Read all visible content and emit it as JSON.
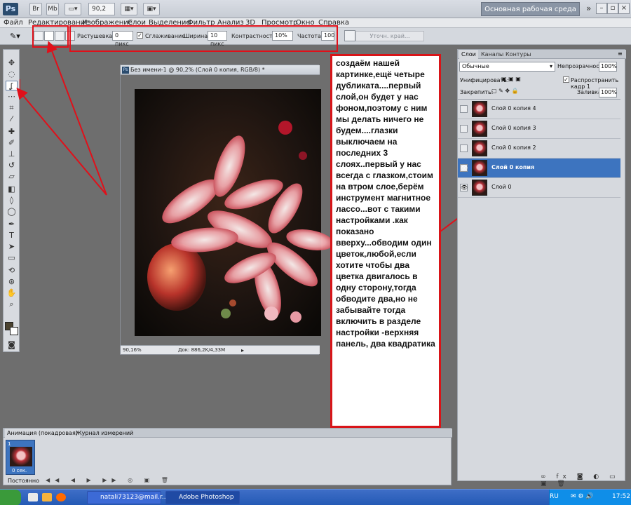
{
  "app": {
    "logo": "Ps",
    "br_label": "Br",
    "mb_label": "Mb",
    "zoom_value": "90,2",
    "workspace_label": "Основная рабочая среда",
    "more_label": "»"
  },
  "menu": [
    "Файл",
    "Редактирование",
    "Изображение",
    "Слои",
    "Выделение",
    "Фильтр",
    "Анализ",
    "3D",
    "Просмотр",
    "Окно",
    "Справка"
  ],
  "options": {
    "feather_label": "Растушевка:",
    "feather_value": "0 пикс",
    "antialias_label": "Сглаживание",
    "width_label": "Ширина:",
    "width_value": "10 пикс",
    "contrast_label": "Контрастность:",
    "contrast_value": "10%",
    "frequency_label": "Частота:",
    "frequency_value": "100",
    "refine_label": "Уточн. край..."
  },
  "document": {
    "title": "Без имени-1 @ 90,2% (Слой 0 копия, RGB/8) *",
    "zoom": "90,16%",
    "doc_info": "Док: 886,2K/4,33M"
  },
  "note": {
    "text": "создаём нашей картинке,ещё четыре дубликата....первый слой,он будет у нас фоном,поэтому с ним мы делать ничего не будем....глазки выключаем на последних 3 слоях..первый у нас всегда с глазком,стоим на втром слое,берём инструмент магнитное лассо...вот с такими настройками  .как показано вверху...обводим один цветок,любой,если хотите чтобы два цветка двигалось в одну сторону,тогда обводите два,но не забывайте тогда включить  в разделе настройки -верхняя панель, два квадратика"
  },
  "layers_panel": {
    "tabs": [
      "Слои",
      "Каналы",
      "Контуры"
    ],
    "blend_mode": "Обычные",
    "opacity_label": "Непрозрачность:",
    "opacity_value": "100%",
    "unify_label": "Унифицировать:",
    "propagate_label": "Распространить кадр 1",
    "lock_label": "Закрепить:",
    "fill_label": "Заливка:",
    "fill_value": "100%",
    "layers": [
      {
        "name": "Слой 0 копия 4",
        "visible": false,
        "selected": false
      },
      {
        "name": "Слой 0 копия 3",
        "visible": false,
        "selected": false
      },
      {
        "name": "Слой 0 копия 2",
        "visible": false,
        "selected": false
      },
      {
        "name": "Слой 0 копия",
        "visible": true,
        "selected": true
      },
      {
        "name": "Слой 0",
        "visible": true,
        "selected": false
      }
    ]
  },
  "animation_panel": {
    "tabs": [
      "Анимация (покадровая)",
      "Журнал измерений"
    ],
    "frame_number": "1",
    "frame_time": "0 сек.",
    "loop_value": "Постоянно"
  },
  "taskbar": {
    "task1": "natali73123@mail.r...",
    "task2": "Adobe Photoshop ...",
    "lang": "RU",
    "time": "17:52"
  },
  "colors": {
    "annotation_red": "#e0101a",
    "selected_layer": "#3d74bf",
    "taskbar_blue": "#245ab5"
  }
}
